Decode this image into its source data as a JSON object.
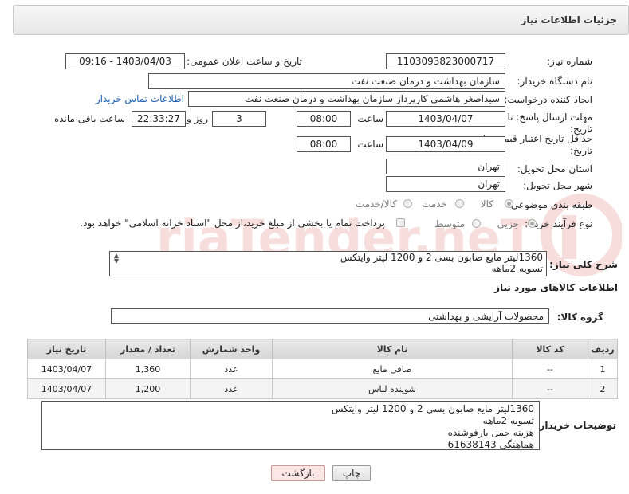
{
  "header": {
    "title": "جزئیات اطلاعات نیاز"
  },
  "form": {
    "need_number_label": "شماره نیاز:",
    "need_number": "1103093823000717",
    "announce_label": "تاریخ و ساعت اعلان عمومی:",
    "announce_value": "1403/04/03 - 09:16",
    "buyer_org_label": "نام دستگاه خریدار:",
    "buyer_org": "سازمان بهداشت و درمان صنعت نفت",
    "creator_label": "ایجاد کننده درخواست:",
    "creator": "سیداصغر هاشمی کارپرداز سازمان بهداشت و درمان صنعت نفت",
    "contact_link": "اطلاعات تماس خریدار",
    "deadline_label_1": "مهلت ارسال پاسخ: تا",
    "deadline_label_2": "تاریخ:",
    "deadline_date": "1403/04/07",
    "time_label": "ساعت",
    "deadline_time": "08:00",
    "days_value": "3",
    "days_label": "روز و",
    "remaining_time": "22:33:27",
    "remaining_label": "ساعت باقی مانده",
    "validity_label_1": "حداقل تاریخ اعتبار قیمت: تا",
    "validity_label_2": "تاریخ:",
    "validity_date": "1403/04/09",
    "validity_time": "08:00",
    "province_label": "استان محل تحویل:",
    "province": "تهران",
    "city_label": "شهر محل تحویل:",
    "city": "تهران",
    "category_label": "طبقه بندی موضوعی:",
    "category_options": [
      "کالا",
      "خدمت",
      "کالا/خدمت"
    ],
    "process_label": "نوع فرآیند خرید :",
    "process_options": [
      "جزیی",
      "متوسط"
    ],
    "payment_note": "پرداخت تمام یا بخشی از مبلغ خرید،از محل \"اسناد خزانه اسلامی\" خواهد بود."
  },
  "summary": {
    "label": "شرح کلی نیاز:",
    "line1": "1360لیتر مایع صابون بسی 2 و 1200 لیتر وایتکس",
    "line2": "تسویه 2ماهه"
  },
  "goods_section": {
    "title": "اطلاعات کالاهای مورد نیاز",
    "group_label": "گروه کالا:",
    "group_value": "محصولات آرایشی و بهداشتی"
  },
  "table": {
    "headers": [
      "ردیف",
      "کد کالا",
      "نام کالا",
      "واحد شمارش",
      "تعداد / مقدار",
      "تاریخ نیاز"
    ],
    "rows": [
      [
        "1",
        "--",
        "صافی مایع",
        "عدد",
        "1,360",
        "1403/04/07"
      ],
      [
        "2",
        "--",
        "شوینده لباس",
        "عدد",
        "1,200",
        "1403/04/07"
      ]
    ]
  },
  "buyer_desc": {
    "label": "توضیحات خریدار:",
    "lines": [
      "1360لیتر مایع صابون بسی 2 و 1200 لیتر وایتکس",
      "تسویه 2ماهه",
      "هزینه حمل بارفوشنده",
      "هماهنگی 61638143"
    ]
  },
  "buttons": {
    "print": "چاپ",
    "back": "بازگشت"
  },
  "watermark": {
    "text": "AriaTender.neT"
  }
}
